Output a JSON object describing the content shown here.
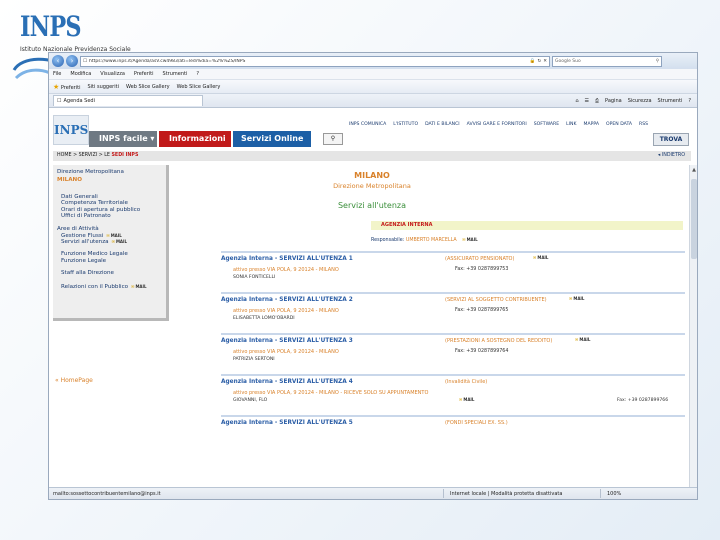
{
  "slide": {
    "logo_text": "INPS",
    "logo_sub": "Istituto Nazionale Previdenza Sociale"
  },
  "browser": {
    "url": "https://www.inps.it/Agenda/asV.cw4983/ati=ledi%dia=%2%%ZS/INPS",
    "search_placeholder": "Google Suo",
    "menu": [
      "File",
      "Modifica",
      "Visualizza",
      "Preferiti",
      "Strumenti",
      "?"
    ],
    "favorites": {
      "label": "Preferiti",
      "items": [
        "Siti suggeriti",
        "Web Slice Gallery",
        "Web Slice Gallery"
      ]
    },
    "tab_title": "Agenda Sedi",
    "tools": [
      "Pagina",
      "Sicurezza",
      "Strumenti"
    ],
    "status_text": "mailto:sossettocontribuentemilano@inps.it",
    "zone": "Internet locale | Modalità protetta disattivata",
    "zoom": "100%"
  },
  "site": {
    "logo": "INPS",
    "top_links": [
      "INPS COMUNICA",
      "L'ISTITUTO",
      "DATI E BILANCI",
      "AVVISI GARE E FORNITORI",
      "SOFTWARE",
      "LINK",
      "MAPPA",
      "OPEN DATA",
      "RSS"
    ],
    "tab_facile": "INPS facile",
    "tab_info": "Informazioni",
    "tab_servizi": "Servizi Online",
    "trova": "TROVA",
    "breadcrumb_prefix": "HOME > SERVIZI > LE ",
    "breadcrumb_current": "SEDI INPS",
    "back": "INDIETRO"
  },
  "sidebar": {
    "dir": "Direzione Metropolitana",
    "city": "MILANO",
    "links": [
      "Dati Generali",
      "Competenza Territoriale",
      "Orari di apertura al pubblico",
      "Uffici di Patronato"
    ],
    "areas_label": "Aree di Attività",
    "area_links": [
      "Gestione Flussi",
      "Servizi all'utenza"
    ],
    "extra_links": [
      "Funzione Medico Legale",
      "Funzione Legale"
    ],
    "staff": "Staff alla Direzione",
    "relazioni": "Relazioni con il Pubblico",
    "mail": "MAIL",
    "homepage": "« HomePage"
  },
  "main": {
    "city": "MILANO",
    "direction": "Direzione Metropolitana",
    "services": "Servizi all'utenza",
    "agenzia": "AGENZIA INTERNA",
    "resp_label": "Responsabile:",
    "resp_value": "UMBERTO MARCELLA",
    "mail": "MAIL",
    "entries": [
      {
        "title": "Agenzia Interna - SERVIZI ALL'UTENZA 1",
        "desc": "(ASSICURATO PENSIONATO)",
        "address": "attivo presso VIA POLA, 9 20124 - MILANO",
        "person": "SONIA FONTICELLI",
        "fax": "Fax: +39 0287899753",
        "fax_right": ""
      },
      {
        "title": "Agenzia Interna - SERVIZI ALL'UTENZA 2",
        "desc": "(SERVIZI AL SOGGETTO CONTRIBUENTE)",
        "address": "attivo presso VIA POLA, 9 20124 - MILANO",
        "person": "ELISABETTA LOMO'OBARDI",
        "fax": "Fax: +39 0287899765",
        "fax_right": ""
      },
      {
        "title": "Agenzia Interna - SERVIZI ALL'UTENZA 3",
        "desc": "(PRESTAZIONI A SOSTEGNO DEL REDDITO)",
        "address": "attivo presso VIA POLA, 9 20124 - MILANO",
        "person": "PATRIZIA SERTONI",
        "fax": "Fax: +39 0287899764",
        "fax_right": ""
      },
      {
        "title": "Agenzia Interna - SERVIZI ALL'UTENZA 4",
        "desc": "(Invalidità Civile)",
        "address": "attivo presso VIA POLA, 9 20124 - MILANO - RICEVE SOLO SU APPUNTAMENTO",
        "person": "GIOVANNI, FLO",
        "fax": "",
        "fax_right": "Fax: +39 0287899766"
      },
      {
        "title": "Agenzia Interna - SERVIZI ALL'UTENZA 5",
        "desc": "(FONDI SPECIALI EX. SS.)",
        "address": "",
        "person": "",
        "fax": "",
        "fax_right": ""
      }
    ]
  }
}
